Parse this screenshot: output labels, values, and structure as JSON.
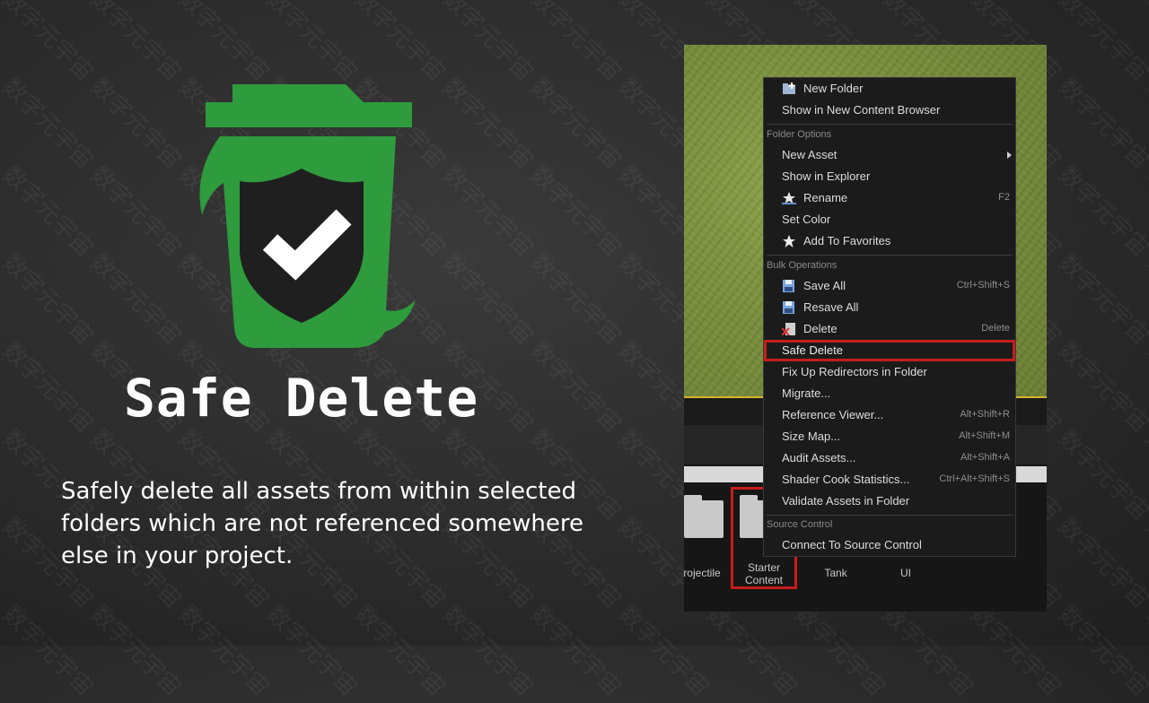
{
  "hero": {
    "title": "Safe Delete",
    "description": "Safely delete all assets from within selected folders which are not referenced somewhere else in your project."
  },
  "watermark": {
    "text": "数字元宇宙"
  },
  "colors": {
    "accent_green": "#2e9b3c",
    "highlight_red": "#c81c1c",
    "menu_bg": "#1b1b1b"
  },
  "context_menu": {
    "top_items": [
      {
        "label": "New Folder",
        "icon": "new-folder-icon"
      },
      {
        "label": "Show in New Content Browser"
      }
    ],
    "folder_options": {
      "header": "Folder Options",
      "items": [
        {
          "label": "New Asset",
          "submenu": true
        },
        {
          "label": "Show in Explorer"
        },
        {
          "label": "Rename",
          "shortcut": "F2",
          "icon": "rename-icon"
        },
        {
          "label": "Set Color"
        },
        {
          "label": "Add To Favorites",
          "icon": "star-icon"
        }
      ]
    },
    "bulk_operations": {
      "header": "Bulk Operations",
      "items": [
        {
          "label": "Save All",
          "shortcut": "Ctrl+Shift+S",
          "icon": "save-icon"
        },
        {
          "label": "Resave All",
          "icon": "save-icon"
        },
        {
          "label": "Delete",
          "shortcut": "Delete",
          "icon": "delete-icon"
        },
        {
          "label": "Safe Delete",
          "highlighted": true
        },
        {
          "label": "Fix Up Redirectors in Folder"
        },
        {
          "label": "Migrate..."
        },
        {
          "label": "Reference Viewer...",
          "shortcut": "Alt+Shift+R"
        },
        {
          "label": "Size Map...",
          "shortcut": "Alt+Shift+M"
        },
        {
          "label": "Audit Assets...",
          "shortcut": "Alt+Shift+A"
        },
        {
          "label": "Shader Cook Statistics...",
          "shortcut": "Ctrl+Alt+Shift+S"
        },
        {
          "label": "Validate Assets in Folder"
        }
      ]
    },
    "source_control": {
      "header": "Source Control",
      "items": [
        {
          "label": "Connect To Source Control"
        }
      ]
    }
  },
  "content_browser": {
    "folders": [
      {
        "label": "rojectile"
      },
      {
        "label_line1": "Starter",
        "label_line2": "Content",
        "selected": true
      },
      {
        "label": "Tank"
      },
      {
        "label": "UI"
      }
    ]
  }
}
